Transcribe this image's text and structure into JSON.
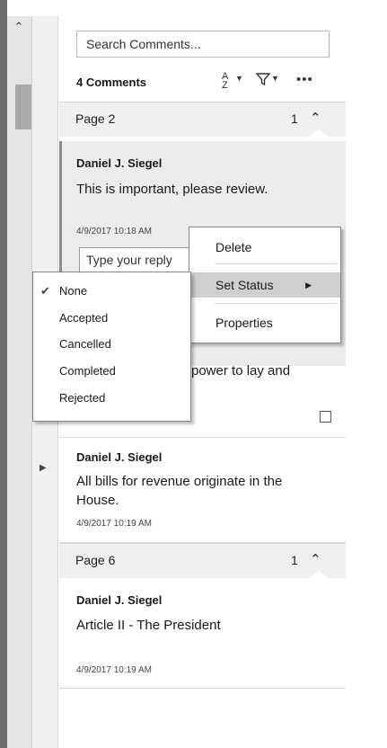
{
  "search": {
    "placeholder": "Search Comments..."
  },
  "toolbar": {
    "count_label": "4 Comments",
    "sort_icon": "sort-a-z-icon",
    "filter_icon": "filter-icon",
    "more_icon": "more-icon"
  },
  "pages": [
    {
      "label": "Page 2",
      "count": "1"
    },
    {
      "label": "Page 6",
      "count": "1"
    }
  ],
  "comments": [
    {
      "author": "Daniel J. Siegel",
      "text": "This is important, please review.",
      "time": "4/9/2017  10:18 AM",
      "reply_placeholder": "Type your reply"
    },
    {
      "text": "power to lay and"
    },
    {
      "author": "Daniel J. Siegel",
      "text_line1": "All bills for revenue originate in the",
      "text_line2": "House.",
      "time": "4/9/2017  10:19 AM"
    },
    {
      "author": "Daniel J. Siegel",
      "text": "Article II - The President",
      "time": "4/9/2017  10:19 AM"
    }
  ],
  "context_menu": {
    "delete": "Delete",
    "set_status": "Set Status",
    "properties": "Properties"
  },
  "status_menu": {
    "none": "None",
    "accepted": "Accepted",
    "cancelled": "Cancelled",
    "completed": "Completed",
    "rejected": "Rejected",
    "selected": "None"
  },
  "colors": {
    "selected_comment_bg": "#ececec",
    "menu_highlight": "#cfcfcf",
    "page_header_bg": "#f0f0f0"
  }
}
